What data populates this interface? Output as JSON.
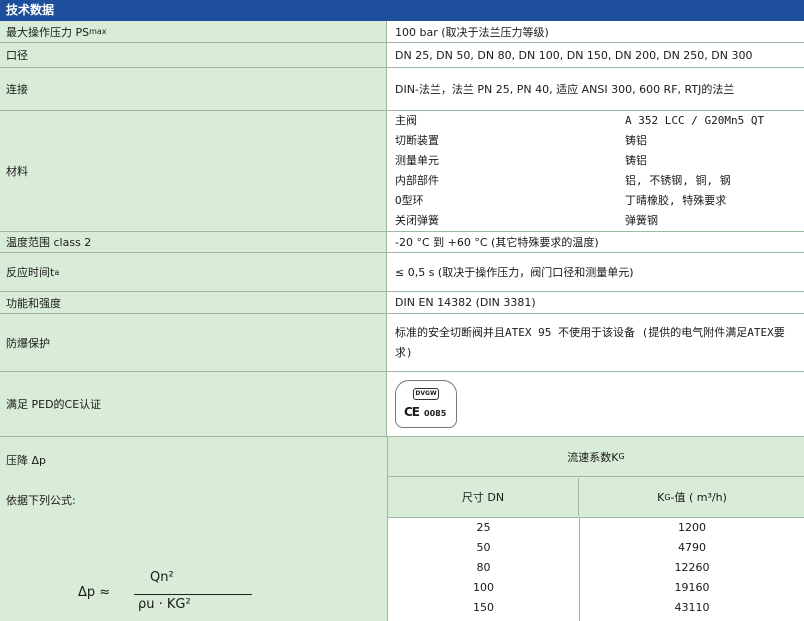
{
  "header": {
    "title": "技术数据"
  },
  "rows": {
    "max_pressure": {
      "label": "最大操作压力 PS",
      "label_sub": "max",
      "value": "100 bar (取决于法兰压力等级)"
    },
    "bore": {
      "label": "口径",
      "value": "DN 25, DN 50, DN 80, DN 100, DN 150, DN 200, DN 250, DN 300"
    },
    "connection": {
      "label": "连接",
      "value": "DIN-法兰，法兰 PN 25, PN 40, 适应 ANSI 300, 600 RF, RTJ的法兰"
    },
    "material": {
      "label": "材料",
      "items": [
        {
          "part": "主阀",
          "material": "A 352 LCC / G20Mn5 QT"
        },
        {
          "part": "切断装置",
          "material": "铸铝"
        },
        {
          "part": "测量单元",
          "material": "铸铝"
        },
        {
          "part": "内部部件",
          "material": "铝, 不锈钢, 铜, 钢"
        },
        {
          "part": "O型环",
          "material": "丁晴橡胶, 特殊要求"
        },
        {
          "part": "关闭弹簧",
          "material": "弹簧钢"
        }
      ]
    },
    "temperature": {
      "label": "温度范围 class 2",
      "value": "-20 °C 到 +60 °C (其它特殊要求的温度)"
    },
    "response": {
      "label": "反应时间t",
      "label_sub": "a",
      "value": "≤ 0,5 s (取决于操作压力，阀门口径和测量单元)"
    },
    "function": {
      "label": "功能和强度",
      "value": "DIN EN 14382 (DIN 3381)"
    },
    "explosion": {
      "label": "防爆保护",
      "value": "标准的安全切断阀并且ATEX 95 不使用于该设备 (提供的电气附件满足ATEX要求)"
    },
    "ped": {
      "label": "满足 PED的CE认证",
      "badge_top": "DVGW",
      "badge_ce": "CE",
      "badge_num": "0085"
    }
  },
  "pressure_drop": {
    "label": "压降 Δp",
    "formula_label": "依据下列公式:",
    "formula": {
      "lhs": "Δp ≈",
      "numerator": "Qn²",
      "denominator": "ρu · KG²"
    },
    "flow_header": "流速系数K",
    "flow_header_sub": "G",
    "col_size": "尺寸 DN",
    "col_kg": "K",
    "col_kg_sub": "G",
    "col_kg_rest": "-值 ( m³/h)",
    "table": [
      {
        "dn": "25",
        "kg": "1200"
      },
      {
        "dn": "50",
        "kg": "4790"
      },
      {
        "dn": "80",
        "kg": "12260"
      },
      {
        "dn": "100",
        "kg": "19160"
      },
      {
        "dn": "150",
        "kg": "43110"
      }
    ]
  }
}
